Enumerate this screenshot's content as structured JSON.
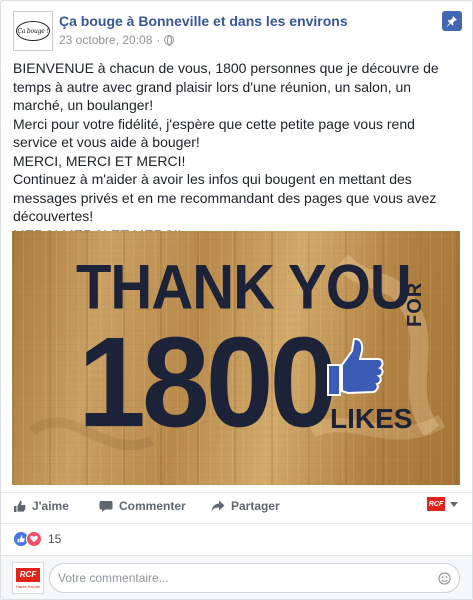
{
  "post": {
    "author": "Ça bouge à Bonneville et dans les environs",
    "avatar_text": "Ça bouge !",
    "timestamp": "23 octobre, 20:08",
    "separator": "·",
    "paragraphs": [
      "BIENVENUE à chacun de vous, 1800 personnes que je découvre de temps à autre avec grand plaisir lors d'une réunion, un salon, un marché, un boulanger!",
      "Merci pour votre fidélité, j'espère que cette petite page vous rend service et vous aide à bouger!",
      "MERCI, MERCI ET MERCI!",
      "Continuez à m'aider à avoir les infos qui bougent en mettant des messages privés et en me recommandant des pages que vous avez découvertes!",
      "MERCI MERCI ET MERCI!"
    ],
    "image": {
      "line1": "THANK YOU",
      "line1_for": "FOR",
      "number": "1800",
      "likes": "LIKES",
      "colors": {
        "wood": "#c39a5c",
        "ink": "#1c2238",
        "thumb": "#3b5bb5"
      }
    }
  },
  "actions": {
    "like": "J'aime",
    "comment": "Commenter",
    "share": "Partager",
    "share_as_logo": "RCF"
  },
  "reactions": {
    "types": [
      "like-icon",
      "love-icon"
    ],
    "count": "15"
  },
  "comment": {
    "placeholder": "Votre commentaire...",
    "avatar_logo": "RCF",
    "avatar_sub": "Haute-Savoie"
  },
  "colors": {
    "link": "#365899",
    "accent": "#4267b2",
    "muted": "#90949c"
  }
}
